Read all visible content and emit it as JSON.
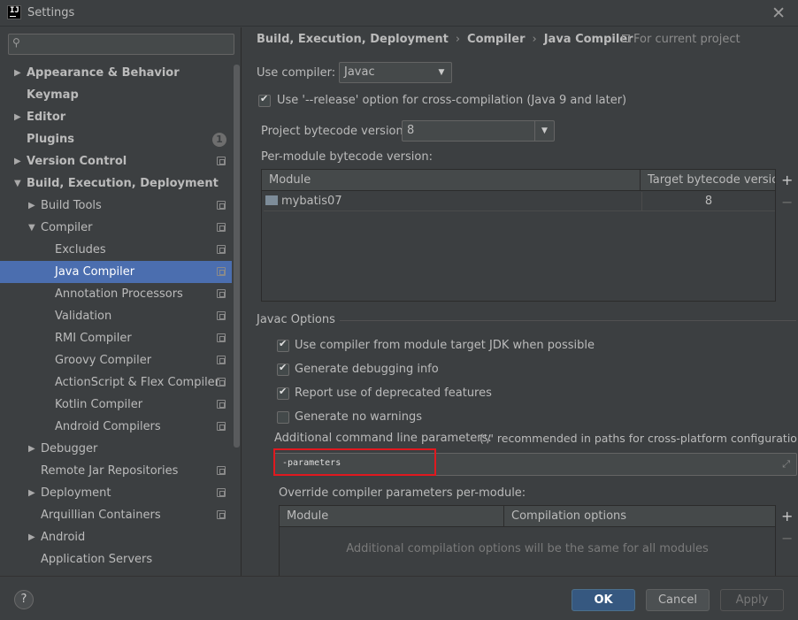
{
  "window": {
    "title": "Settings",
    "close_glyph": "✕",
    "app_icon_letter": "IJ"
  },
  "search": {
    "placeholder": "",
    "icon": "search-icon"
  },
  "tree": {
    "items": [
      {
        "label": "Appearance & Behavior",
        "bold": true,
        "arrow": "right",
        "project_icon": false
      },
      {
        "label": "Keymap",
        "bold": true,
        "arrow": "",
        "project_icon": false
      },
      {
        "label": "Editor",
        "bold": true,
        "arrow": "right",
        "project_icon": false
      },
      {
        "label": "Plugins",
        "bold": true,
        "arrow": "",
        "project_icon": false,
        "badge": "1"
      },
      {
        "label": "Version Control",
        "bold": true,
        "arrow": "right",
        "project_icon": true
      },
      {
        "label": "Build, Execution, Deployment",
        "bold": true,
        "arrow": "down",
        "project_icon": false
      },
      {
        "label": "Build Tools",
        "bold": false,
        "arrow": "right",
        "project_icon": true
      },
      {
        "label": "Compiler",
        "bold": false,
        "arrow": "down",
        "project_icon": true
      },
      {
        "label": "Excludes",
        "bold": false,
        "arrow": "",
        "project_icon": true
      },
      {
        "label": "Java Compiler",
        "bold": false,
        "arrow": "",
        "project_icon": true,
        "selected": true
      },
      {
        "label": "Annotation Processors",
        "bold": false,
        "arrow": "",
        "project_icon": true
      },
      {
        "label": "Validation",
        "bold": false,
        "arrow": "",
        "project_icon": true
      },
      {
        "label": "RMI Compiler",
        "bold": false,
        "arrow": "",
        "project_icon": true
      },
      {
        "label": "Groovy Compiler",
        "bold": false,
        "arrow": "",
        "project_icon": true
      },
      {
        "label": "ActionScript & Flex Compiler",
        "bold": false,
        "arrow": "",
        "project_icon": true
      },
      {
        "label": "Kotlin Compiler",
        "bold": false,
        "arrow": "",
        "project_icon": true
      },
      {
        "label": "Android Compilers",
        "bold": false,
        "arrow": "",
        "project_icon": true
      },
      {
        "label": "Debugger",
        "bold": false,
        "arrow": "right",
        "project_icon": false
      },
      {
        "label": "Remote Jar Repositories",
        "bold": false,
        "arrow": "",
        "project_icon": true
      },
      {
        "label": "Deployment",
        "bold": false,
        "arrow": "right",
        "project_icon": true
      },
      {
        "label": "Arquillian Containers",
        "bold": false,
        "arrow": "",
        "project_icon": true
      },
      {
        "label": "Android",
        "bold": false,
        "arrow": "right",
        "project_icon": false
      },
      {
        "label": "Application Servers",
        "bold": false,
        "arrow": "",
        "project_icon": false
      }
    ]
  },
  "breadcrumb": {
    "parts": [
      "Build, Execution, Deployment",
      "Java Compiler"
    ],
    "middle": "Compiler",
    "separator": "›",
    "for_project": "For current project"
  },
  "compiler": {
    "use_compiler_label": "Use compiler:",
    "use_compiler_value": "Javac",
    "release_option_label": "Use '--release' option for cross-compilation (Java 9 and later)",
    "release_option_checked": true,
    "bytecode_label": "Project bytecode version:",
    "bytecode_value": "8",
    "per_module_label": "Per-module bytecode version:"
  },
  "module_table": {
    "col_module": "Module",
    "col_target": "Target bytecode version",
    "rows": [
      {
        "module": "mybatis07",
        "target": "8"
      }
    ],
    "add": "+",
    "remove": "−"
  },
  "javac": {
    "group_title": "Javac Options",
    "options": [
      {
        "label": "Use compiler from module target JDK when possible",
        "checked": true
      },
      {
        "label": "Generate debugging info",
        "checked": true
      },
      {
        "label": "Report use of deprecated features",
        "checked": true
      },
      {
        "label": "Generate no warnings",
        "checked": false
      }
    ],
    "additional_label": "Additional command line parameters:",
    "additional_hint": "('/' recommended in paths for cross-platform configurations)",
    "additional_value": "-parameters",
    "override_label": "Override compiler parameters per-module:"
  },
  "override_table": {
    "col_module": "Module",
    "col_options": "Compilation options",
    "empty_text": "Additional compilation options will be the same for all modules",
    "add": "+",
    "remove": "−"
  },
  "buttons": {
    "help": "?",
    "ok": "OK",
    "cancel": "Cancel",
    "apply": "Apply"
  },
  "colors": {
    "selection": "#4b6eaf",
    "ok_button": "#365880",
    "highlight_box": "#e0191f",
    "background": "#3c3f41"
  }
}
